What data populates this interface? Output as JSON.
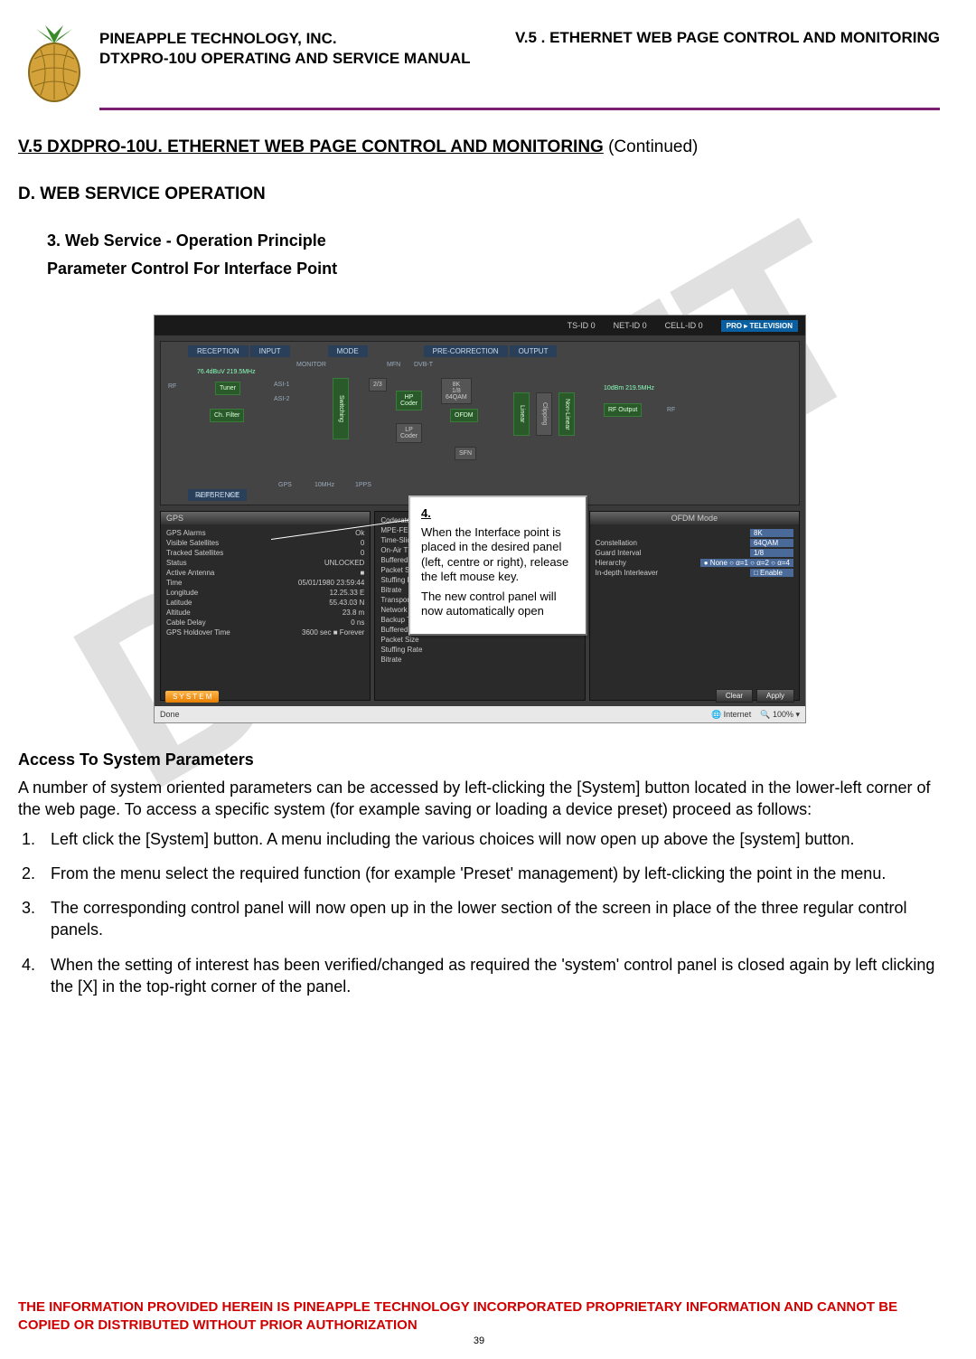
{
  "header": {
    "company": "PINEAPPLE TECHNOLOGY, INC.",
    "manual": "DTXPRO-10U OPERATING AND SERVICE MANUAL",
    "section_ref": "V.5 . ETHERNET WEB PAGE CONTROL AND MONITORING"
  },
  "watermark": "DRAFT",
  "titles": {
    "main": "V.5 DXDPRO-10U. ETHERNET WEB PAGE CONTROL AND MONITORING",
    "continued": " (Continued)",
    "sub_d": "D.  WEB SERVICE OPERATION",
    "sub_3": "3.    Web Service - Operation Principle",
    "param": "Parameter Control For Interface Point"
  },
  "screenshot": {
    "topbar": {
      "ts": "TS-ID 0",
      "net": "NET-ID 0",
      "cell": "CELL-ID 0",
      "brand": "PRO ▸ TELEVISION"
    },
    "tabs": [
      "RECEPTION",
      "INPUT",
      "MODE",
      "PRE-CORRECTION",
      "OUTPUT"
    ],
    "blocks": {
      "rf": "RF",
      "tuner": "Tuner",
      "chfilter": "Ch. Filter",
      "monitor": "MONITOR",
      "asi1": "ASI-1",
      "asi2": "ASI-2",
      "mfn": "MFN",
      "dvbt": "DVB-T",
      "hp": "HP\nCoder",
      "lp": "LP\nCoder",
      "m23": "2/3",
      "m8k": "8K\n1/8\n64QAM",
      "ofdm": "OFDM",
      "linear": "Linear",
      "nonlinear": "Non-Linear",
      "sfn": "SFN",
      "rfout": "RF Output",
      "sig1": "76.4dBuV\n219.5MHz",
      "sig2": "10dBm\n219.5MHz",
      "rf2": "RF"
    },
    "reference": {
      "title": "REFERENCE",
      "auto": "AUTO",
      "int": "INT",
      "gps": "GPS",
      "ten": "10MHz",
      "pps": "1PPS"
    },
    "panels": {
      "left": {
        "title": "GPS",
        "rows": [
          [
            "GPS Alarms",
            "Ok"
          ],
          [
            "Visible Satellites",
            "0"
          ],
          [
            "Tracked Satellites",
            "0"
          ],
          [
            "Status",
            "UNLOCKED"
          ],
          [
            "Active Antenna",
            "■"
          ],
          [
            "Time",
            "05/01/1980 23:59:44"
          ],
          [
            "Longitude",
            "12.25.33 E"
          ],
          [
            "Latitude",
            "55.43.03 N"
          ],
          [
            "Altitude",
            "23.8        m"
          ],
          [
            "Cable Delay",
            "0           ns"
          ],
          [
            "GPS Holdover Time",
            "3600   sec  ■ Forever"
          ]
        ]
      },
      "mid": {
        "rows": [
          [
            "Coderate",
            ""
          ],
          [
            "MPE-FEC",
            ""
          ],
          [
            "Time-Slicing",
            ""
          ],
          [
            "On-Air TS",
            ""
          ],
          [
            "Buffered Packets",
            ""
          ],
          [
            "Packet Size",
            ""
          ],
          [
            "Stuffing Rate",
            ""
          ],
          [
            "Bitrate",
            ""
          ],
          [
            "Transport Stream",
            ""
          ],
          [
            "Network ID",
            ""
          ],
          [
            "Backup TS",
            ""
          ],
          [
            "Buffered Packets",
            ""
          ],
          [
            "Packet Size",
            ""
          ],
          [
            "Stuffing Rate",
            ""
          ],
          [
            "Bitrate",
            ""
          ]
        ]
      },
      "right": {
        "title": "OFDM Mode",
        "rows": [
          [
            "",
            "8K"
          ],
          [
            "Constellation",
            "64QAM"
          ],
          [
            "Guard Interval",
            "1/8"
          ],
          [
            "Hierarchy",
            "● None  ○ α=1  ○ α=2  ○ α=4"
          ],
          [
            "In-depth Interleaver",
            "□ Enable"
          ]
        ]
      }
    },
    "system_btn": "S Y S T E M",
    "btns": {
      "clear": "Clear",
      "apply": "Apply"
    },
    "status": {
      "done": "Done",
      "internet": "Internet",
      "zoom": "100%"
    }
  },
  "callout": {
    "num": "4.",
    "p1": "When the Interface point is placed in the desired panel (left, centre or right), release the left mouse key.",
    "p2": "The new control panel will now automatically open"
  },
  "body": {
    "h_access": "Access To System Parameters",
    "p_intro": "A number of system oriented parameters can be accessed by left-clicking the [System] button located in the lower-left corner of the web page. To access a specific system (for example saving or loading a device preset) proceed as follows:",
    "steps": [
      "Left click the [System] button. A menu including the various choices will now open up above the [system] button.",
      "From the menu select the required function (for example 'Preset' management) by left-clicking the point in the menu.",
      "The corresponding control panel will now open up in the lower section of the screen in place of the three regular control panels.",
      "When the setting of interest has been verified/changed as required the 'system' control panel is closed again by left clicking the [X] in the top-right corner of the panel."
    ]
  },
  "footer": {
    "red": "THE INFORMATION PROVIDED HEREIN IS PINEAPPLE TECHNOLOGY INCORPORATED PROPRIETARY INFORMATION AND CANNOT BE COPIED OR DISTRIBUTED WITHOUT PRIOR AUTHORIZATION",
    "page": "39"
  }
}
